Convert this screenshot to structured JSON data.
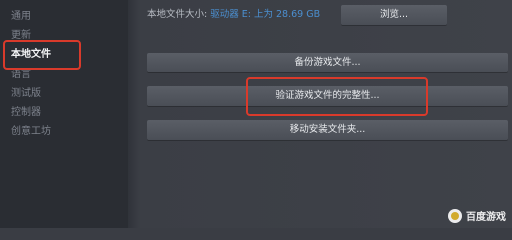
{
  "sidebar": {
    "items": [
      {
        "label": "通用",
        "active": false
      },
      {
        "label": "更新",
        "active": false
      },
      {
        "label": "本地文件",
        "active": true
      },
      {
        "label": "语言",
        "active": false
      },
      {
        "label": "测试版",
        "active": false
      },
      {
        "label": "控制器",
        "active": false
      },
      {
        "label": "创意工坊",
        "active": false
      }
    ]
  },
  "main": {
    "size_label": "本地文件大小:",
    "size_value": "驱动器 E: 上为 28.69 GB",
    "browse_label": "浏览...",
    "backup_label": "备份游戏文件...",
    "verify_label": "验证游戏文件的完整性...",
    "move_label": "移动安装文件夹..."
  },
  "watermark": {
    "text": "百度游戏"
  },
  "colors": {
    "highlight": "#d93a2b",
    "link": "#4b8fd0",
    "button": "#4f535b"
  }
}
